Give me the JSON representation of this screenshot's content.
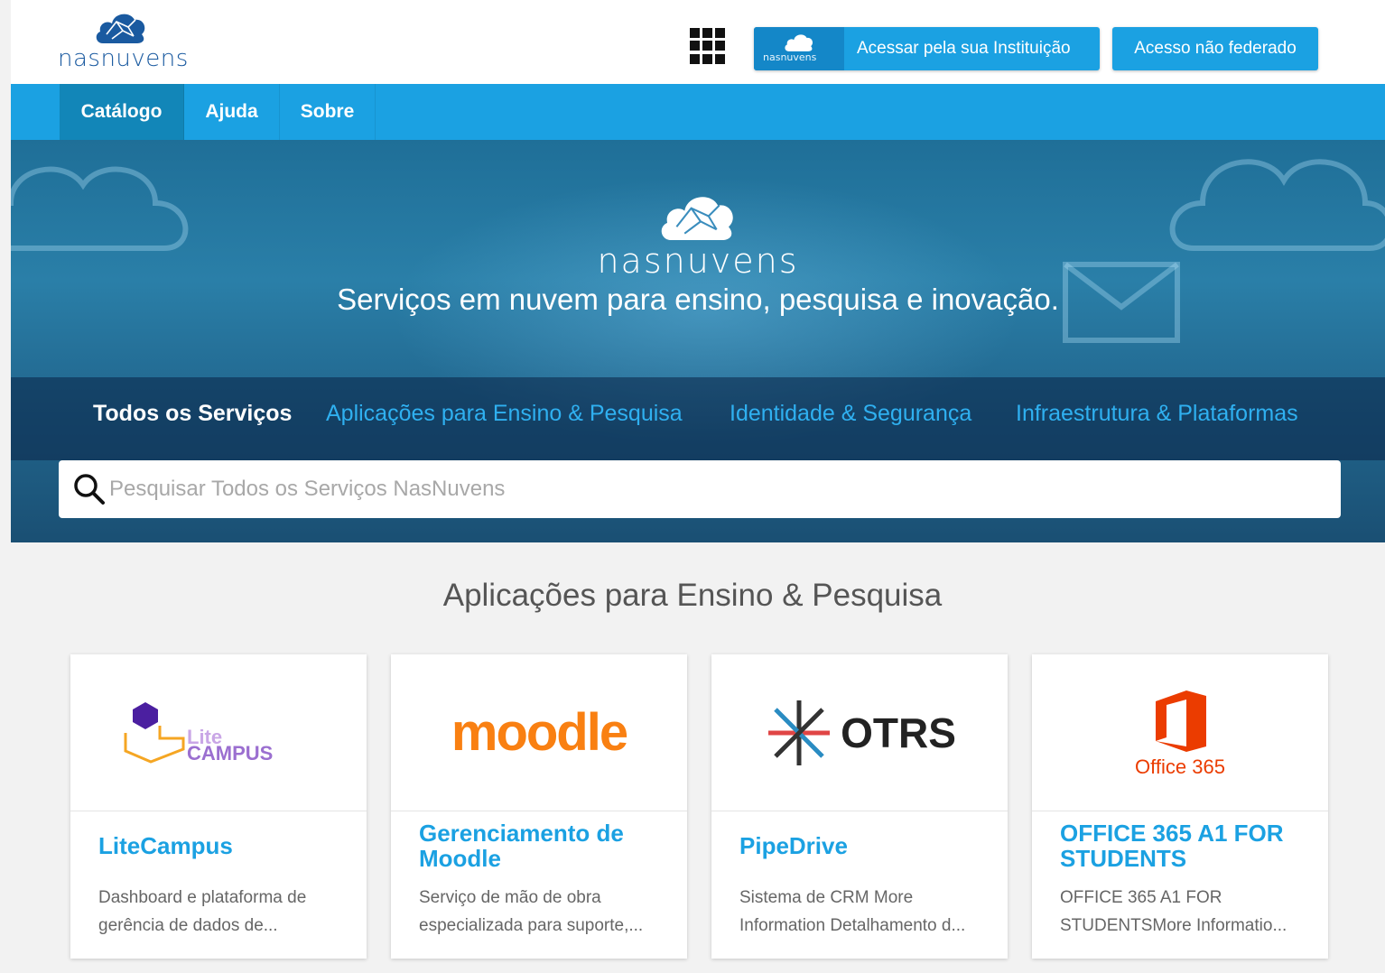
{
  "header": {
    "logo_text": "nasnuvens",
    "btn_institution_logo": "nasnuvens",
    "btn_institution_label": "Acessar pela sua Instituição",
    "btn_non_federated_label": "Acesso não federado"
  },
  "nav": {
    "items": [
      {
        "label": "Catálogo"
      },
      {
        "label": "Ajuda"
      },
      {
        "label": "Sobre"
      }
    ]
  },
  "hero": {
    "logo_text": "nasnuvens",
    "tagline": "Serviços em nuvem para ensino, pesquisa e inovação.",
    "tabs": [
      {
        "label": "Todos os Serviços"
      },
      {
        "label": "Aplicações para Ensino & Pesquisa"
      },
      {
        "label": "Identidade & Segurança"
      },
      {
        "label": "Infraestrutura & Plataformas"
      }
    ],
    "search": {
      "placeholder": "Pesquisar Todos os Serviços NasNuvens",
      "value": ""
    }
  },
  "section": {
    "title": "Aplicações para Ensino & Pesquisa",
    "cards": [
      {
        "logo_top": "Lite",
        "logo_bottom": "CAMPUS",
        "title": "LiteCampus",
        "desc": "Dashboard e plataforma de gerência de dados de..."
      },
      {
        "logo": "moodle",
        "title": "Gerenciamento de Moodle",
        "desc": "Serviço de mão de obra especializada para suporte,..."
      },
      {
        "logo": "OTRS",
        "title": "PipeDrive",
        "desc": "Sistema de CRM   More Information Detalhamento d..."
      },
      {
        "logo": "Office 365",
        "title": "OFFICE 365 A1 FOR STUDENTS",
        "desc": "OFFICE 365 A1 FOR STUDENTSMore Informatio..."
      }
    ]
  },
  "colors": {
    "accent": "#1ba1e2",
    "nav_active": "#1286b8",
    "logo_blue": "#1a5aa0"
  }
}
